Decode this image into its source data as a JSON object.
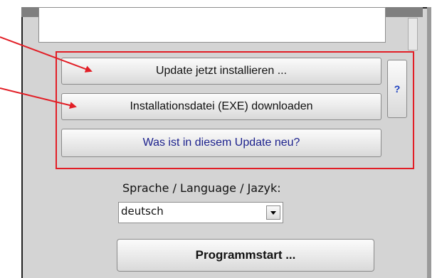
{
  "update_panel": {
    "install_now_label": "Update jetzt installieren ...",
    "download_exe_label": "Installationsdatei (EXE) downloaden",
    "whats_new_label": "Was ist in diesem Update neu?",
    "help_label": "?"
  },
  "language": {
    "label": "Sprache / Language / Jazyk:",
    "selected": "deutsch"
  },
  "start_button_label": "Programmstart ...",
  "colors": {
    "annotation_red": "#e21e26",
    "link_blue": "#1a1f8c",
    "window_gray": "#d4d4d4"
  },
  "icons": {
    "annotation_arrows": "arrow-icon",
    "dropdown": "chevron-down-icon"
  }
}
